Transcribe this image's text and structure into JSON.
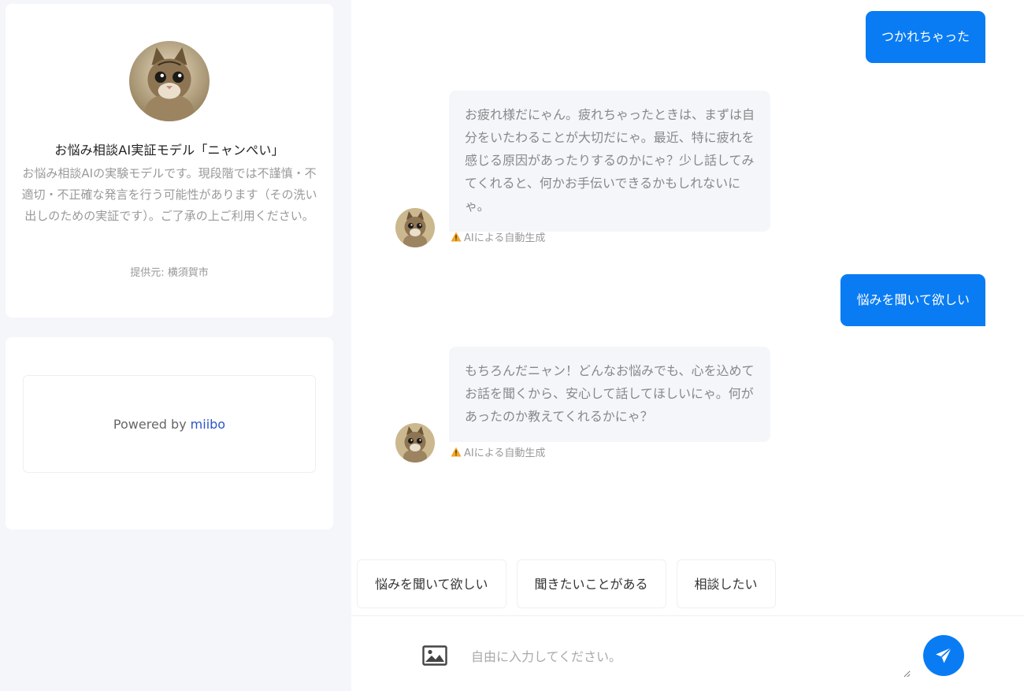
{
  "profile": {
    "name": "お悩み相談AI実証モデル「ニャンぺい」",
    "description": "お悩み相談AIの実験モデルです。現段階では不謹慎・不適切・不正確な発言を行う可能性があります（その洗い出しのための実証です）。ご了承の上ご利用ください。",
    "provider": "提供元: 横須賀市"
  },
  "powered": {
    "prefix": "Powered by",
    "link": "miibo"
  },
  "messages": [
    {
      "role": "user",
      "text": "つかれちゃった"
    },
    {
      "role": "bot",
      "text": "お疲れ様だにゃん。疲れちゃったときは、まずは自分をいたわることが大切だにゃ。最近、特に疲れを感じる原因があったりするのかにゃ？少し話してみてくれると、何かお手伝いできるかもしれないにゃ。",
      "note": "AIによる自動生成"
    },
    {
      "role": "user",
      "text": "悩みを聞いて欲しい"
    },
    {
      "role": "bot",
      "text": "もちろんだニャン！どんなお悩みでも、心を込めてお話を聞くから、安心して話してほしいにゃ。何があったのか教えてくれるかにゃ？",
      "note": "AIによる自動生成"
    }
  ],
  "quick_replies": [
    "悩みを聞いて欲しい",
    "聞きたいことがある",
    "相談したい"
  ],
  "input": {
    "placeholder": "自由に入力してください。"
  },
  "colors": {
    "accent": "#0a7cf3",
    "bot_bubble": "#f4f6fa",
    "warning": "#f5a623"
  },
  "icons": {
    "image_button": "image-icon",
    "send_button": "paper-plane-icon",
    "ai_note": "warning-icon"
  }
}
